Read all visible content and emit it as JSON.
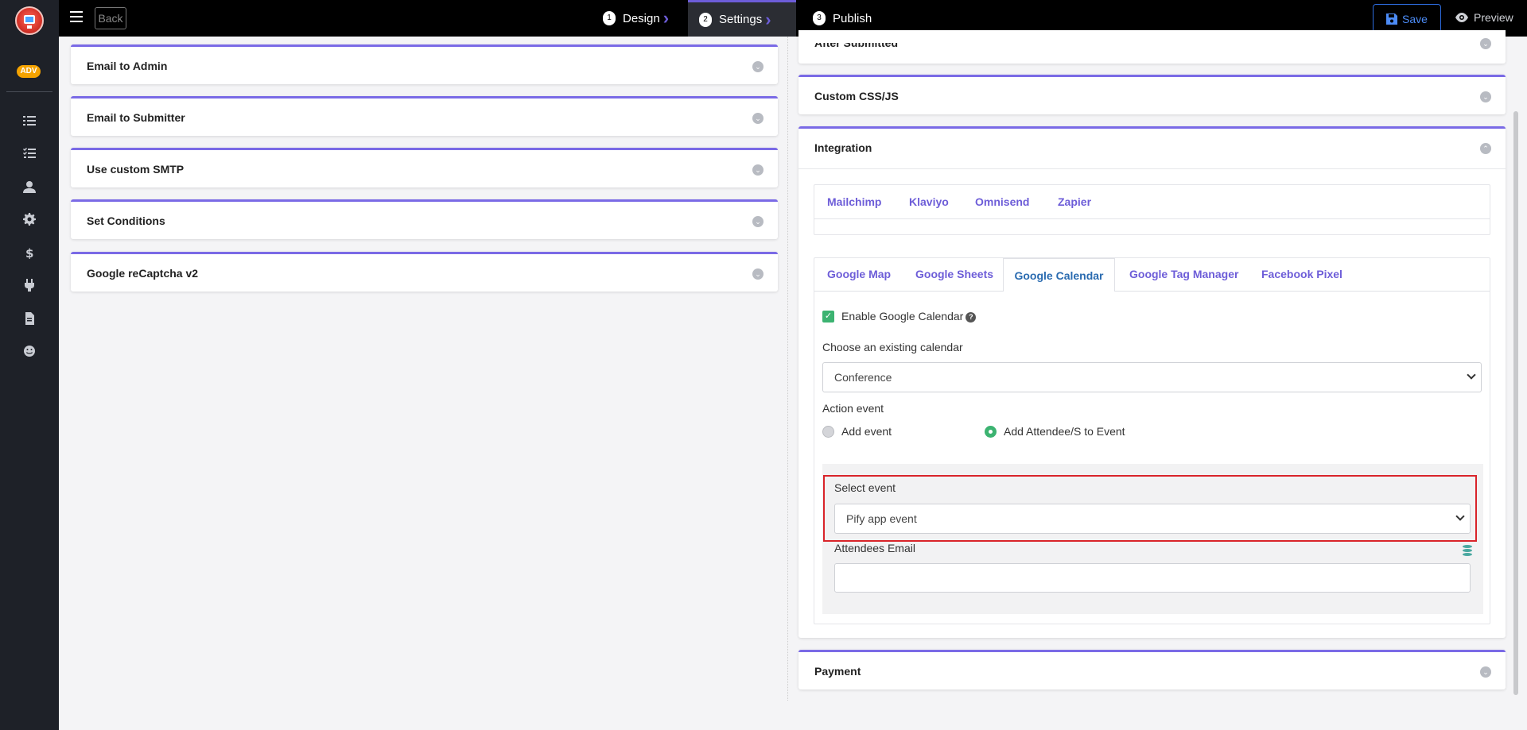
{
  "topbar": {
    "back_label": "Back",
    "steps": [
      {
        "num": "1",
        "label": "Design"
      },
      {
        "num": "2",
        "label": "Settings"
      },
      {
        "num": "3",
        "label": "Publish"
      }
    ],
    "save_label": "Save",
    "preview_label": "Preview"
  },
  "sidebar": {
    "badge": "ADV",
    "icons": [
      "list-icon",
      "checklist-icon",
      "user-icon",
      "gear-icon",
      "dollar-icon",
      "plug-icon",
      "document-icon",
      "smile-icon"
    ]
  },
  "left_panels": [
    {
      "title": "Email to Admin"
    },
    {
      "title": "Email to Submitter"
    },
    {
      "title": "Use custom SMTP"
    },
    {
      "title": "Set Conditions"
    },
    {
      "title": "Google reCaptcha v2"
    }
  ],
  "right_panels": {
    "after_submitted": "After Submitted",
    "custom_css": "Custom CSS/JS",
    "integration": "Integration",
    "payment": "Payment"
  },
  "integration": {
    "tabs_top": [
      "Mailchimp",
      "Klaviyo",
      "Omnisend",
      "Zapier"
    ],
    "tabs_google": [
      "Google Map",
      "Google Sheets",
      "Google Calendar",
      "Google Tag Manager",
      "Facebook Pixel"
    ],
    "active_tab": "Google Calendar",
    "enable_label": "Enable Google Calendar",
    "enable_checked": true,
    "choose_calendar_label": "Choose an existing calendar",
    "calendar_value": "Conference",
    "action_event_label": "Action event",
    "radio_add_event": "Add event",
    "radio_add_attendee": "Add Attendee/S to Event",
    "selected_action": "Add Attendee/S to Event",
    "select_event_label": "Select event",
    "select_event_value": "Pify app event",
    "attendees_label": "Attendees Email",
    "attendees_value": ""
  },
  "colors": {
    "accent": "#7a6ae6",
    "save_blue": "#2d6cdf",
    "check_green": "#3cb371",
    "highlight_red": "#d9242a"
  }
}
